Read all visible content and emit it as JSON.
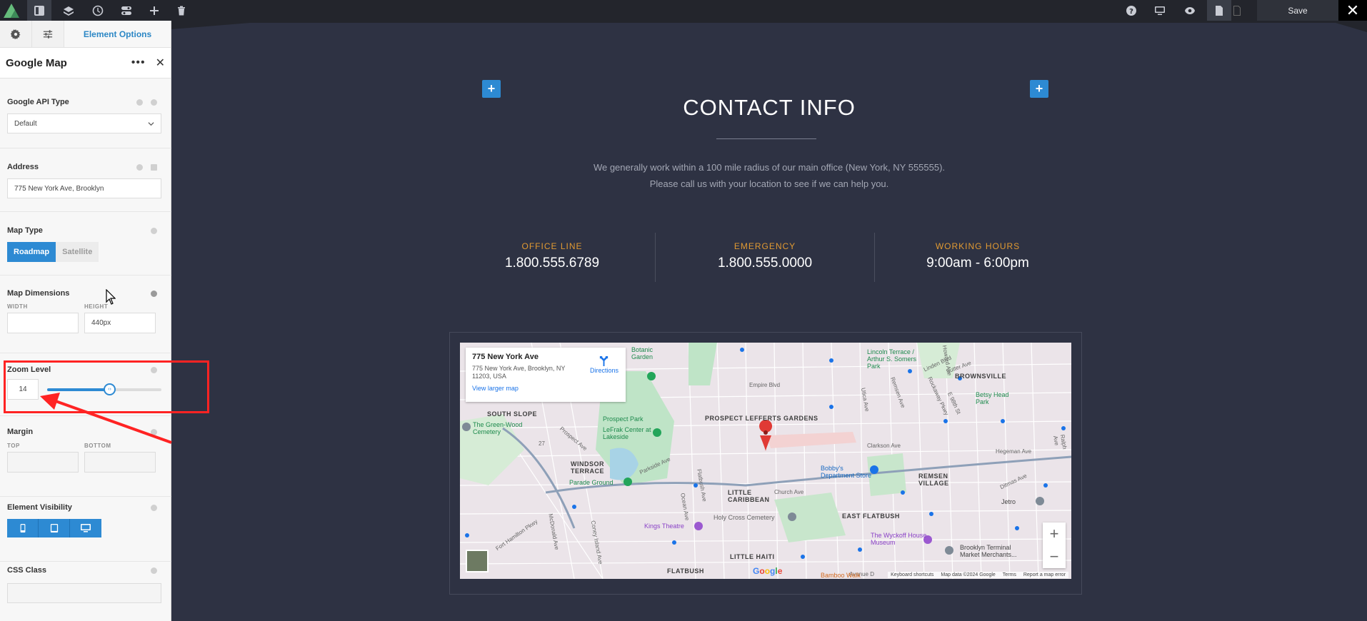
{
  "toolbar": {
    "save_label": "Save",
    "close_label": "✕",
    "left_icons": [
      "layout-icon",
      "layers-icon",
      "history-icon",
      "toggles-icon",
      "plus-icon",
      "trash-icon"
    ],
    "right_icons": [
      "help-icon",
      "desktop-icon",
      "preview-icon",
      "page-icon",
      "page-outline-icon"
    ]
  },
  "panel": {
    "tab_label": "Element Options",
    "element_title": "Google Map",
    "fields": {
      "api_type": {
        "label": "Google API Type",
        "value": "Default"
      },
      "address": {
        "label": "Address",
        "value": "775 New York Ave, Brooklyn"
      },
      "map_type": {
        "label": "Map Type",
        "options": [
          "Roadmap",
          "Satellite"
        ],
        "selected": "Roadmap"
      },
      "dimensions": {
        "label": "Map Dimensions",
        "width_label": "WIDTH",
        "height_label": "HEIGHT",
        "width_value": "",
        "height_value": "440px"
      },
      "zoom": {
        "label": "Zoom Level",
        "value": "14",
        "slider_fraction": 0.55
      },
      "margin": {
        "label": "Margin",
        "top_label": "TOP",
        "bottom_label": "BOTTOM"
      },
      "visibility": {
        "label": "Element Visibility",
        "icons": [
          "mobile-icon",
          "tablet-icon",
          "desktop-icon"
        ]
      },
      "css_class": {
        "label": "CSS Class"
      }
    }
  },
  "canvas": {
    "title": "CONTACT INFO",
    "description_line1": "We generally work within a 100 mile radius of our main office (New York, NY 555555).",
    "description_line2": "Please call us with your location to see if we can help you.",
    "stats": [
      {
        "label": "OFFICE LINE",
        "value": "1.800.555.6789"
      },
      {
        "label": "EMERGENCY",
        "value": "1.800.555.0000"
      },
      {
        "label": "WORKING HOURS",
        "value": "9:00am - 6:00pm"
      }
    ],
    "add_button_label": "+"
  },
  "map": {
    "card_title": "775 New York Ave",
    "card_address": "775 New York Ave, Brooklyn, NY 11203, USA",
    "card_link": "View larger map",
    "directions": "Directions",
    "zoom_in": "+",
    "zoom_out": "−",
    "google": "Google",
    "footer": [
      "Keyboard shortcuts",
      "Map data ©2024 Google",
      "Terms",
      "Report a map error"
    ],
    "bamboo": "Bamboo Walk",
    "labels": {
      "prospect_lefferts": "PROSPECT LEFFERTS GARDENS",
      "south_slope": "SOUTH SLOPE",
      "windsor_terrace": "WINDSOR TERRACE",
      "little_caribbean": "LITTLE CARIBBEAN",
      "east_flatbush": "EAST FLATBUSH",
      "little_haiti": "LITTLE HAITI",
      "flatbush": "FLATBUSH",
      "brownsville": "BROWNSVILLE",
      "remsen_village": "REMSEN VILLAGE",
      "green_wood": "The Green-Wood Cemetery",
      "prospect_park": "Prospect Park",
      "lefrak": "LeFrak Center at Lakeside",
      "parade_ground": "Parade Ground",
      "kings_theatre": "Kings Theatre",
      "holy_cross": "Holy Cross Cemetery",
      "bobbys": "Bobby's Department Store",
      "wyckoff": "The Wyckoff House Museum",
      "brooklyn_terminal": "Brooklyn Terminal Market Merchants...",
      "jetro": "Jetro",
      "betsy_head": "Betsy Head Park",
      "lincoln_terrace": "Lincoln Terrace / Arthur S. Somers Park",
      "botanic": "Botanic Garden",
      "empire_blvd": "Empire Blvd",
      "church_ave": "Church Ave",
      "clarkson_ave": "Clarkson Ave",
      "hegeman_ave": "Hegeman Ave",
      "parkside_ave": "Parkside Ave",
      "prospect_ave": "Prospect Ave",
      "fort_hamilton": "Fort Hamilton Pkwy",
      "ocean_ave": "Ocean Ave",
      "coney_island": "Coney Island Ave",
      "mcdonald": "McDonald Ave",
      "flatbush_ave": "Flatbush Ave",
      "utica_ave": "Utica Ave",
      "remsen_ave": "Remsen Ave",
      "rockaway": "Rockaway Pkwy",
      "e98": "E 98th St",
      "linden": "Linden Blvd",
      "sutter": "Sutter Ave",
      "howard": "Howard Ave",
      "ralph": "Ralph Ave",
      "ditmas": "Ditmas Ave",
      "avenue_d": "Avenue D",
      "ave_27": "27"
    }
  }
}
